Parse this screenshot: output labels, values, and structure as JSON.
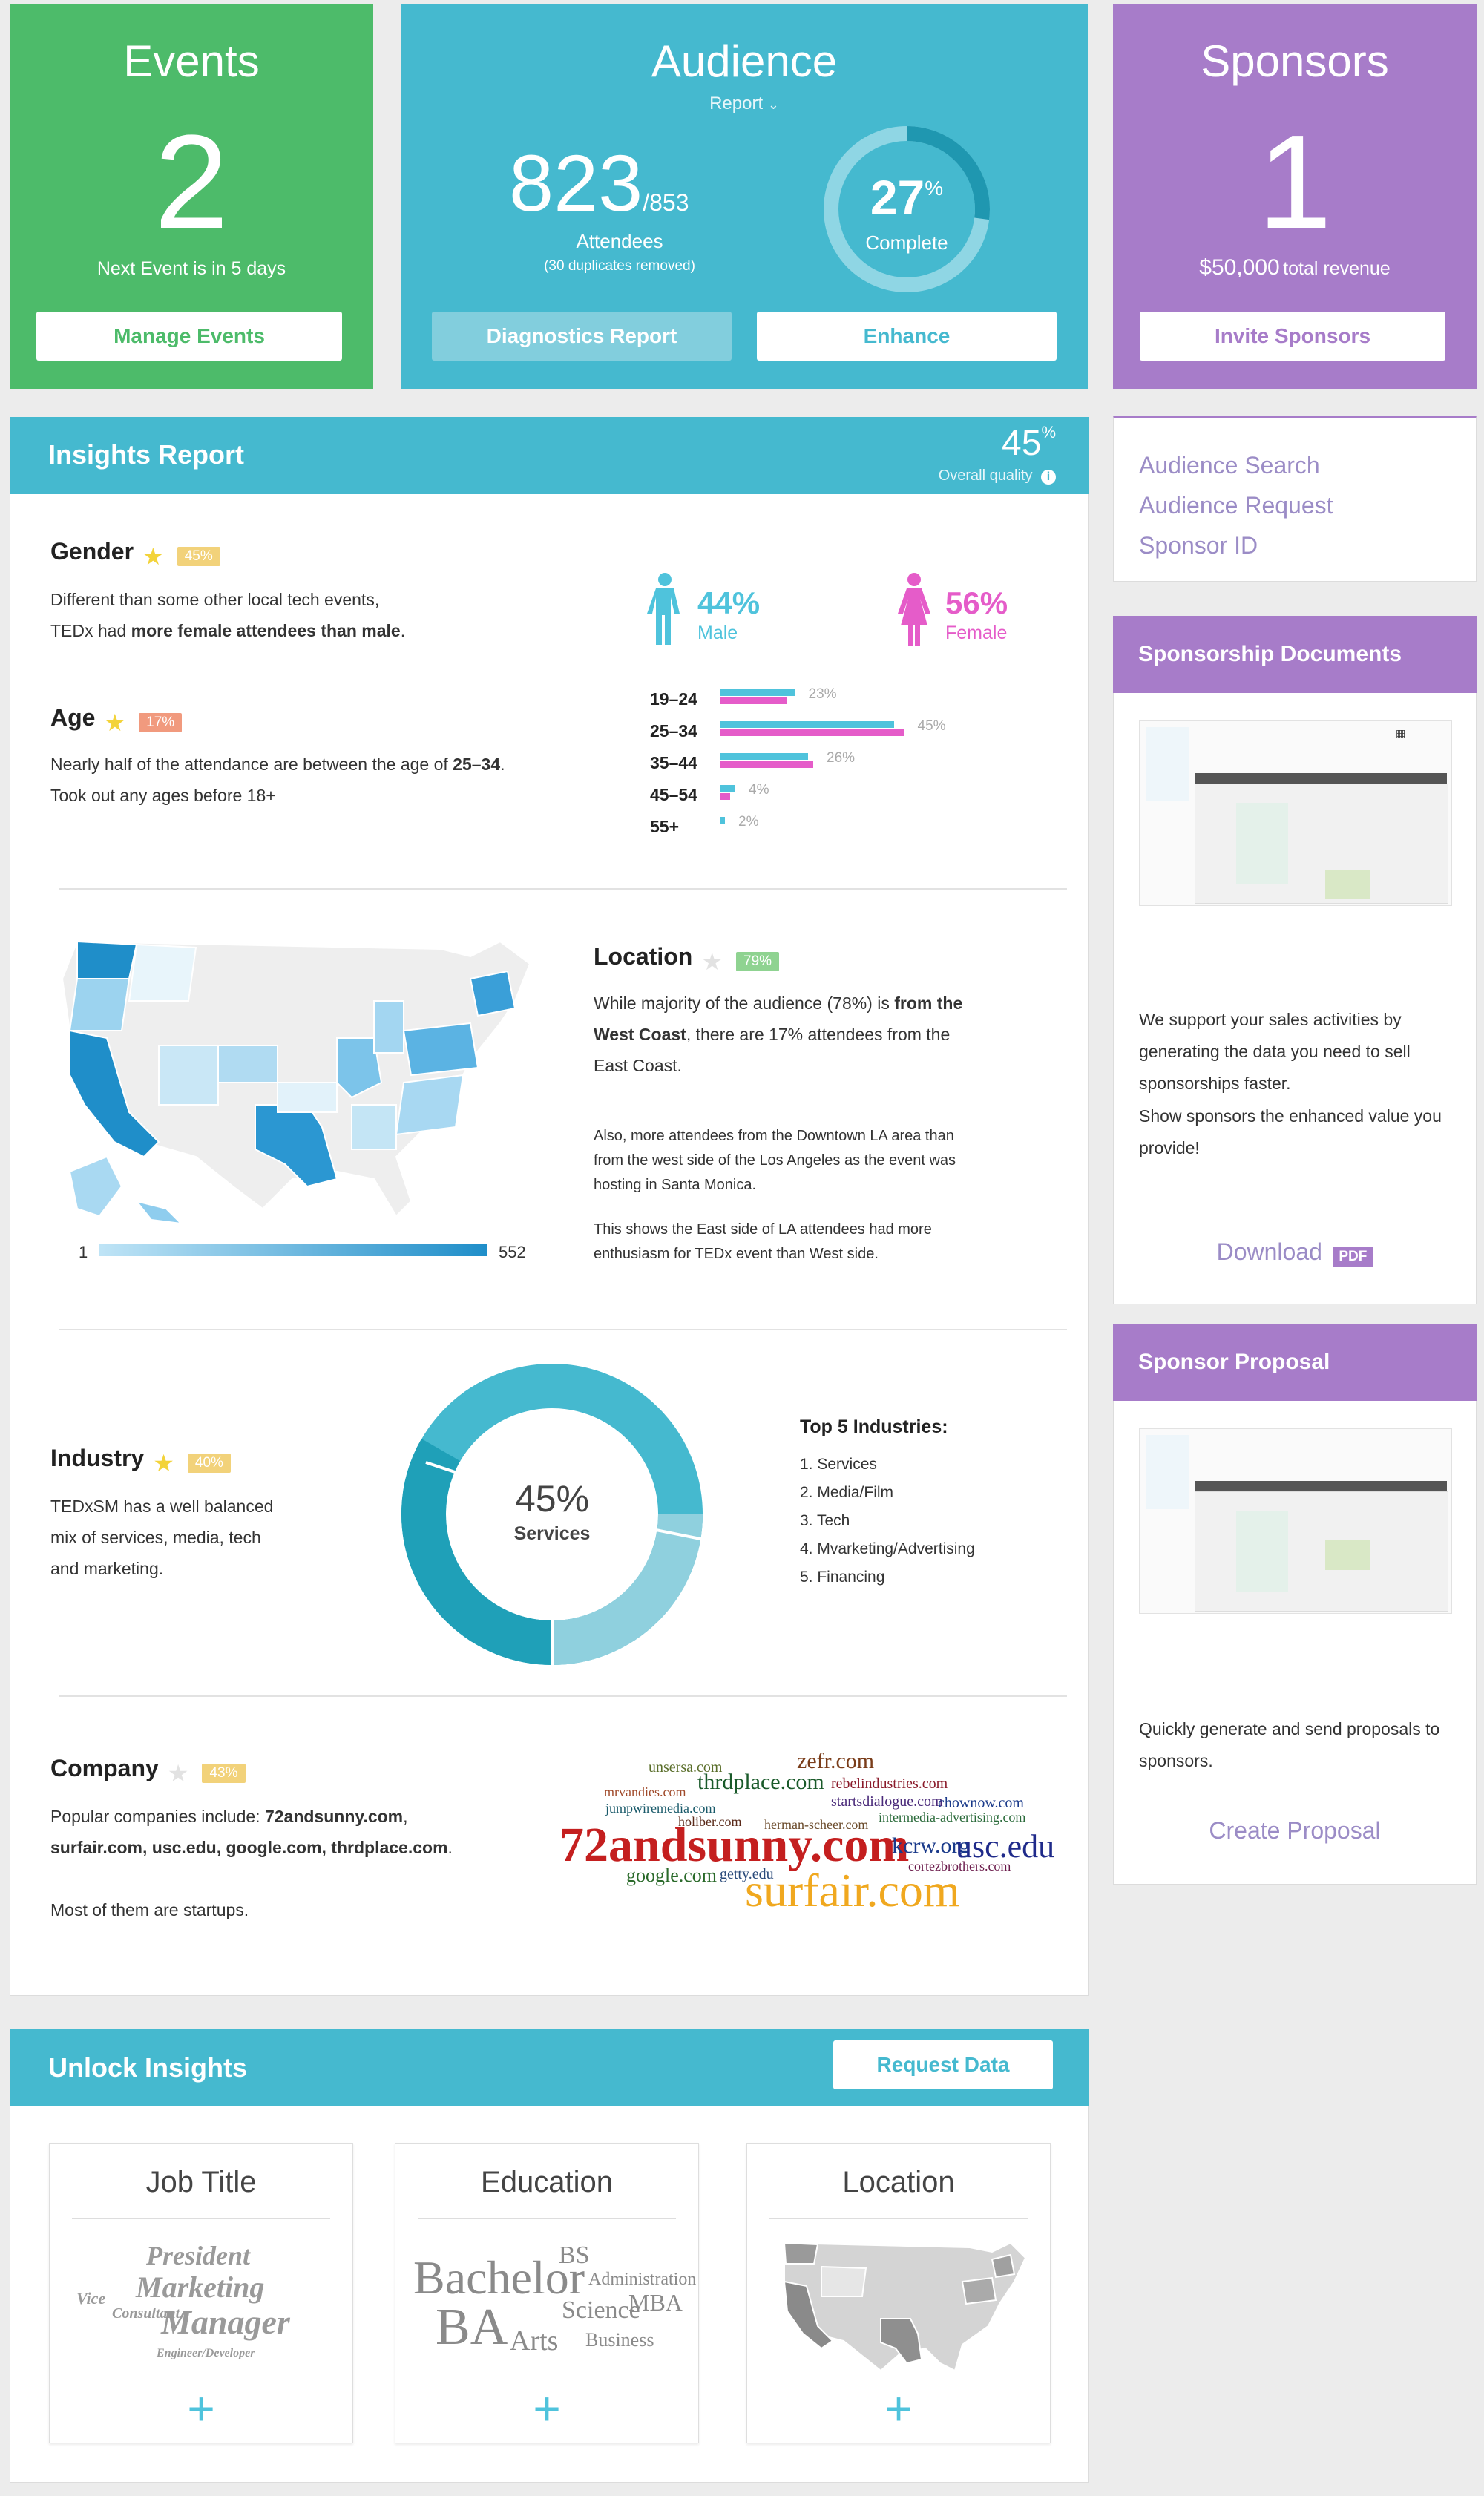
{
  "colors": {
    "green": "#4dbb6a",
    "teal": "#45b9cf",
    "purple": "#a77cc9",
    "male": "#4fc3dc",
    "female": "#e55cc9"
  },
  "events": {
    "title": "Events",
    "count": "2",
    "subtitle": "Next Event is in 5 days",
    "button": "Manage Events"
  },
  "audience": {
    "title": "Audience",
    "report": "Report",
    "attendees": "823",
    "total": "/853",
    "attendees_label": "Attendees",
    "duplicates": "(30 duplicates removed)",
    "complete_pct": "27",
    "pct_sign": "%",
    "complete_label": "Complete",
    "complete_fraction": 0.27,
    "diag_button": "Diagnostics Report",
    "enhance_button": "Enhance"
  },
  "sponsors": {
    "title": "Sponsors",
    "count": "1",
    "revenue_amount": "$50,000",
    "revenue_label": "total revenue",
    "button": "Invite Sponsors"
  },
  "insights": {
    "title": "Insights Report",
    "quality": "45",
    "quality_sign": "%",
    "quality_label": "Overall quality",
    "gender": {
      "title": "Gender",
      "tag": "45%",
      "line1": "Different than some other local tech events,",
      "line2_a": "TEDx had ",
      "line2_b": "more female attendees than male",
      ".": ".",
      "male_pct": "44%",
      "male_label": "Male",
      "female_pct": "56%",
      "female_label": "Female"
    },
    "age": {
      "title": "Age",
      "tag": "17%",
      "line1_a": "Nearly half of the attendance are between the age of ",
      "line1_b": "25–34",
      ".": ".",
      "line2": "Took out any ages before 18+",
      "rows": [
        {
          "label": "19–24",
          "pct": "23%",
          "male": 0.29,
          "female": 0.26
        },
        {
          "label": "25–34",
          "pct": "45%",
          "male": 0.67,
          "female": 0.71
        },
        {
          "label": "35–44",
          "pct": "26%",
          "male": 0.34,
          "female": 0.36
        },
        {
          "label": "45–54",
          "pct": "4%",
          "male": 0.06,
          "female": 0.04
        },
        {
          "label": "55+",
          "pct": "2%",
          "male": 0.02,
          "female": 0.0
        }
      ]
    },
    "location": {
      "title": "Location",
      "tag": "79%",
      "p1_a": "While majority of the audience (78%) is ",
      "p1_b": "from the West Coast",
      ",": ",",
      "p1_c": " there are 17% attendees from the East Coast.",
      "p2": "Also, more attendees from the Downtown LA area than from the west side of the Los Angeles as the event was hosting in Santa Monica.",
      "p3": "This shows the East side of LA attendees had more enthusiasm for TEDx event than West side.",
      "legend_min": "1",
      "legend_max": "552"
    },
    "industry": {
      "title": "Industry",
      "tag": "40%",
      "desc1": "TEDxSM has a well balanced",
      "desc2": "mix of services, media, tech",
      "desc3": "and marketing.",
      "center_pct": "45%",
      "center_label": "Services",
      "top_title": "Top 5 Industries:",
      "top": [
        "1. Services",
        "2. Media/Film",
        "3. Tech",
        "4. Mvarketing/Advertising",
        "5. Financing"
      ]
    },
    "company": {
      "title": "Company",
      "tag": "43%",
      "line1_a": "Popular companies include: ",
      "line1_b": "72andsunny.com",
      ",": ",",
      "line2": "surfair.com, usc.edu, google.com, thrdplace.com",
      "line2_end": ".",
      "line3": "Most of them are startups.",
      "cloud": [
        "72andsunny.com",
        "surfair.com",
        "usc.edu",
        "thrdplace.com",
        "zefr.com",
        "google.com",
        "kcrw.org",
        "rebelindustries.com",
        "startsdialogue.com",
        "chownow.com",
        "holiber.com",
        "herman-scheer.com",
        "cortezbrothers.com",
        "intermedia-advertising.com",
        "mrvandies.com",
        "jumpwiremedia.com",
        "unsersa.com",
        "getty.edu"
      ]
    }
  },
  "sidebar_links": [
    "Audience Search",
    "Audience Request",
    "Sponsor ID"
  ],
  "sponsorship_docs": {
    "title": "Sponsorship Documents",
    "p1": "We support your sales activities by generating the data you need to sell sponsorships faster.",
    "p2": "Show sponsors the enhanced value you provide!",
    "download": "Download",
    "pdf": "PDF"
  },
  "sponsor_proposal": {
    "title": "Sponsor Proposal",
    "p1": "Quickly generate and send proposals to sponsors.",
    "link": "Create Proposal"
  },
  "unlock": {
    "title": "Unlock Insights",
    "button": "Request Data",
    "cards": [
      {
        "title": "Job Title",
        "words": [
          "President",
          "Marketing",
          "Manager",
          "Vice",
          "Consultant",
          "Engineer/Developer"
        ]
      },
      {
        "title": "Education",
        "words": [
          "Bachelor",
          "BA",
          "Arts",
          "Science",
          "MBA",
          "BS",
          "Business",
          "Administration"
        ]
      },
      {
        "title": "Location"
      }
    ],
    "plus": "+"
  }
}
